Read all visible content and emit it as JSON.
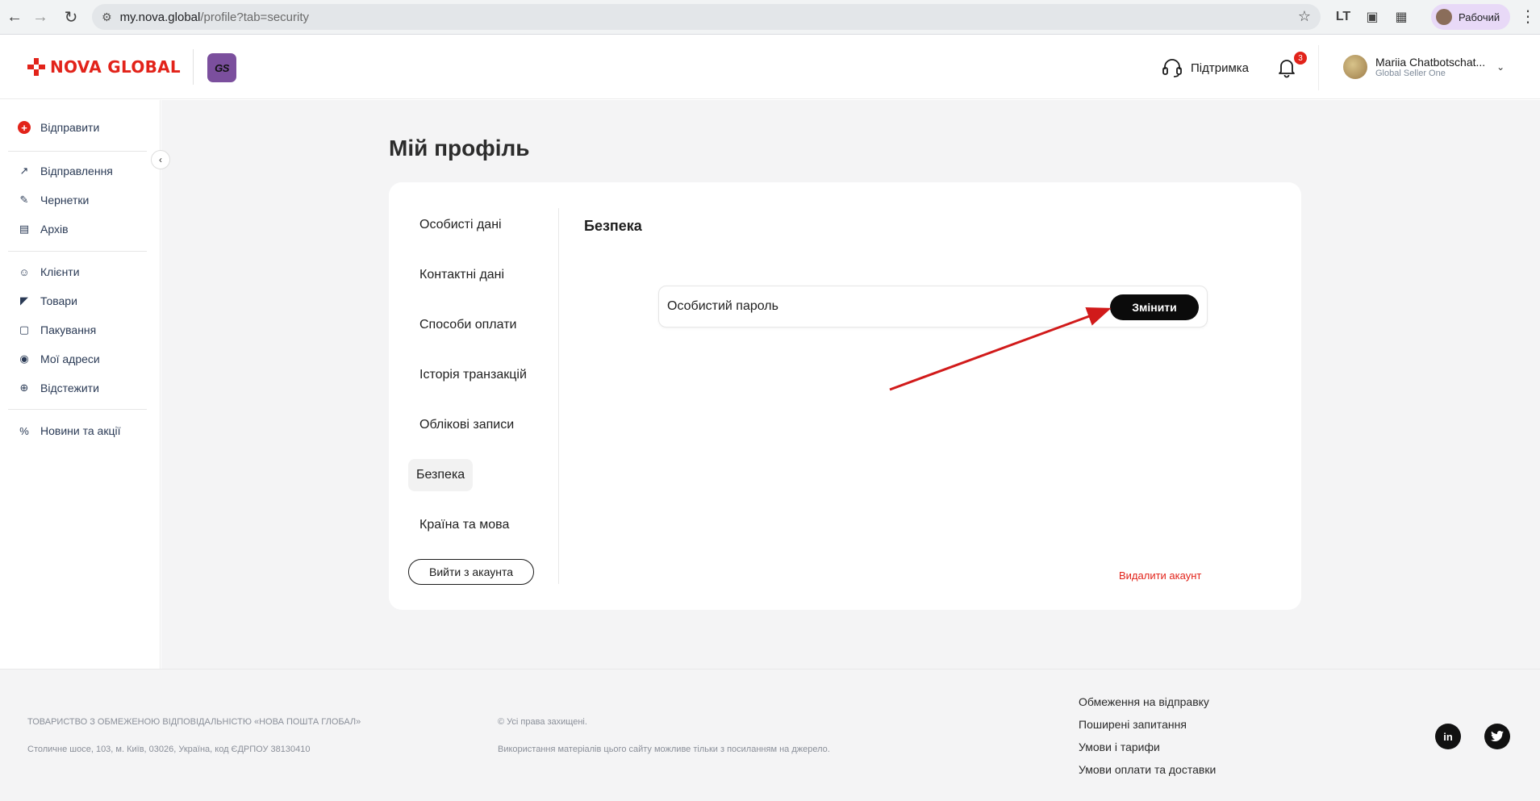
{
  "browser": {
    "url_host": "my.nova.global",
    "url_path": "/profile?tab=security",
    "profile_label": "Рабочий"
  },
  "header": {
    "logo_text": "NOVA GLOBAL",
    "badge_text": "GS",
    "support_label": "Підтримка",
    "notification_count": "3",
    "user_name": "Mariia Chatbotschat...",
    "user_company": "Global Seller One"
  },
  "sidebar": {
    "primary": "Відправити",
    "items": [
      {
        "label": "Відправлення",
        "icon": "arrow-up-right-icon"
      },
      {
        "label": "Чернетки",
        "icon": "edit-icon"
      },
      {
        "label": "Архів",
        "icon": "archive-icon"
      },
      {
        "label": "Клієнти",
        "icon": "users-icon"
      },
      {
        "label": "Товари",
        "icon": "tag-icon"
      },
      {
        "label": "Пакування",
        "icon": "box-icon"
      },
      {
        "label": "Мої адреси",
        "icon": "location-icon"
      },
      {
        "label": "Відстежити",
        "icon": "track-icon"
      },
      {
        "label": "Новини та акції",
        "icon": "percent-icon"
      }
    ]
  },
  "main": {
    "page_title": "Мій профіль",
    "tabs": [
      {
        "label": "Особисті дані"
      },
      {
        "label": "Контактні дані"
      },
      {
        "label": "Способи оплати"
      },
      {
        "label": "Історія транзакцій"
      },
      {
        "label": "Облікові записи"
      },
      {
        "label": "Безпека"
      },
      {
        "label": "Країна та мова"
      }
    ],
    "active_tab": "Безпека",
    "logout_label": "Вийти з акаунта",
    "section_title": "Безпека",
    "password_label": "Особистий пароль",
    "change_label": "Змінити",
    "delete_label": "Видалити акаунт"
  },
  "footer": {
    "company": "ТОВАРИСТВО З ОБМЕЖЕНОЮ ВІДПОВІДАЛЬНІСТЮ «НОВА ПОШТА ГЛОБАЛ»",
    "address": "Столичне шосе, 103, м. Київ, 03026, Україна, код ЄДРПОУ 38130410",
    "rights": "© Усі права захищені.",
    "usage": "Використання матеріалів цього сайту можливе тільки з посиланням на джерело.",
    "links": [
      "Обмеження на відправку",
      "Поширені запитання",
      "Умови і тарифи",
      "Умови оплати та доставки"
    ],
    "social": {
      "linkedin": "in",
      "twitter": "t"
    }
  },
  "colors": {
    "brand_red": "#e2231a",
    "button_black": "#0b0b0b",
    "badge_purple": "#7b4f9d",
    "background": "#f4f4f5"
  }
}
